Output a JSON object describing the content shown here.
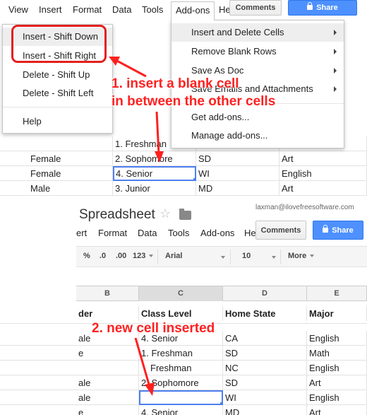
{
  "top": {
    "menubar": {
      "items": [
        "View",
        "Insert",
        "Format",
        "Data",
        "Tools",
        "Add-ons",
        "He"
      ],
      "comments": "Comments",
      "share": "Share"
    },
    "insert_menu": {
      "items": [
        "Insert - Shift Down",
        "Insert - Shift Right",
        "Delete - Shift Up",
        "Delete - Shift Left",
        "Help"
      ],
      "highlighted_index": 0
    },
    "addons_menu": {
      "items": [
        "Insert and Delete Cells",
        "Remove Blank Rows",
        "Save As Doc",
        "Save Emails and Attachments",
        "Get add-ons...",
        "Manage add-ons..."
      ]
    },
    "grid_rows": [
      [
        "",
        "1. Freshman",
        "",
        ""
      ],
      [
        "Female",
        "2. Sophomore",
        "SD",
        "Art"
      ],
      [
        "Female",
        "4. Senior",
        "WI",
        "English"
      ],
      [
        "Male",
        "3. Junior",
        "MD",
        "Art"
      ]
    ]
  },
  "annotations": {
    "step1_line1": "1. insert a blank cell",
    "step1_line2": "in between the other cells",
    "step2": "2. new cell inserted"
  },
  "bottom": {
    "title": "Spreadsheet",
    "email": "laxman@ilovefreesoftware.com",
    "menubar": [
      "ert",
      "Format",
      "Data",
      "Tools",
      "Add-ons",
      "He"
    ],
    "comments": "Comments",
    "share": "Share",
    "toolbar": {
      "percent": "%",
      "dec_dec": ".0",
      "inc_dec": ".00",
      "more_formats": "123",
      "font": "Arial",
      "font_size": "10",
      "more": "More"
    },
    "column_headers": [
      "B",
      "C",
      "D",
      "E"
    ],
    "header_row": [
      "der",
      "Class Level",
      "Home State",
      "Major"
    ],
    "rows": [
      [
        "ale",
        "4. Senior",
        "CA",
        "English"
      ],
      [
        "e",
        "1. Freshman",
        "SD",
        "Math"
      ],
      [
        "",
        "Freshman",
        "NC",
        "English"
      ],
      [
        "ale",
        "2. Sophomore",
        "SD",
        "Art"
      ],
      [
        "ale",
        "",
        "WI",
        "English"
      ],
      [
        "e",
        "4. Senior",
        "MD",
        "Art"
      ]
    ]
  },
  "colors": {
    "share_button": "#4d90fe",
    "annotation": "#ff2020",
    "selection": "#4d7ff0"
  }
}
